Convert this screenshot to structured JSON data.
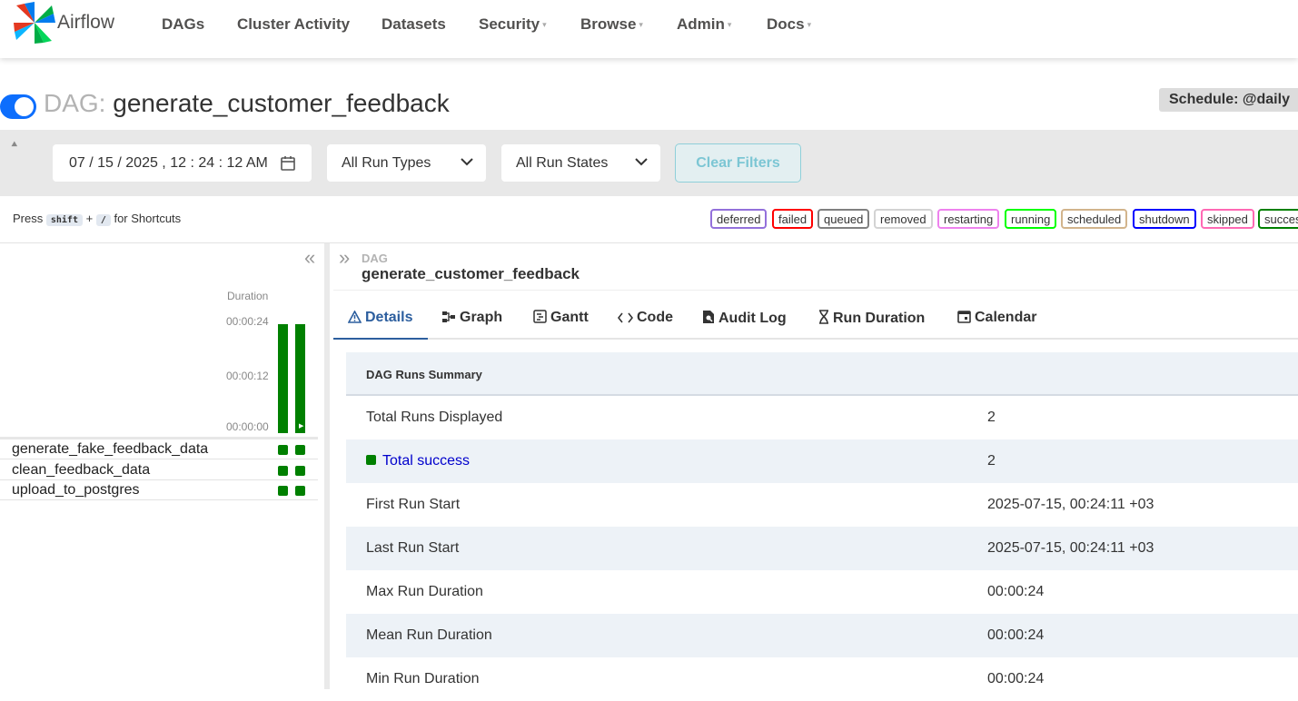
{
  "nav": {
    "brand": "Airflow",
    "items": [
      {
        "label": "DAGs",
        "dropdown": false
      },
      {
        "label": "Cluster Activity",
        "dropdown": false
      },
      {
        "label": "Datasets",
        "dropdown": false
      },
      {
        "label": "Security",
        "dropdown": true
      },
      {
        "label": "Browse",
        "dropdown": true
      },
      {
        "label": "Admin",
        "dropdown": true
      },
      {
        "label": "Docs",
        "dropdown": true
      }
    ]
  },
  "header": {
    "prefix": "DAG:",
    "dag_id": "generate_customer_feedback",
    "schedule": "Schedule: @daily",
    "paused": false
  },
  "filters": {
    "date": "07 / 15 / 2025 ,   12 : 24 : 12    AM",
    "run_types": "All Run Types",
    "run_states": "All Run States",
    "clear_label": "Clear Filters"
  },
  "shortcuts": {
    "press": "Press",
    "key1": "shift",
    "plus": "+",
    "key2": "/",
    "suffix": "for Shortcuts"
  },
  "states": [
    {
      "label": "deferred",
      "color": "#9370db"
    },
    {
      "label": "failed",
      "color": "#ff0000"
    },
    {
      "label": "queued",
      "color": "#808080"
    },
    {
      "label": "removed",
      "color": "#d3d3d3"
    },
    {
      "label": "restarting",
      "color": "#ee82ee"
    },
    {
      "label": "running",
      "color": "#00ff00"
    },
    {
      "label": "scheduled",
      "color": "#d2b48c"
    },
    {
      "label": "shutdown",
      "color": "#0000ff"
    },
    {
      "label": "skipped",
      "color": "#ff69b4"
    },
    {
      "label": "success",
      "color": "#008000"
    }
  ],
  "grid": {
    "duration_label": "Duration",
    "ticks": [
      "00:00:24",
      "00:00:12",
      "00:00:00"
    ],
    "runs": [
      {
        "duration_fraction": 1.0,
        "state": "success"
      },
      {
        "duration_fraction": 1.0,
        "state": "success"
      }
    ],
    "tasks": [
      {
        "name": "generate_fake_feedback_data"
      },
      {
        "name": "clean_feedback_data"
      },
      {
        "name": "upload_to_postgres"
      }
    ]
  },
  "details": {
    "label": "DAG",
    "title": "generate_customer_feedback",
    "tabs": [
      {
        "label": "Details",
        "icon": "warning-triangle-icon"
      },
      {
        "label": "Graph",
        "icon": "graph-icon"
      },
      {
        "label": "Gantt",
        "icon": "gantt-icon"
      },
      {
        "label": "Code",
        "icon": "code-icon"
      },
      {
        "label": "Audit Log",
        "icon": "audit-log-icon"
      },
      {
        "label": "Run Duration",
        "icon": "hourglass-icon"
      },
      {
        "label": "Calendar",
        "icon": "calendar-icon"
      }
    ],
    "summary_title": "DAG Runs Summary",
    "rows": [
      {
        "key": "Total Runs Displayed",
        "value": "2"
      },
      {
        "key": "Total success",
        "value": "2"
      },
      {
        "key": "First Run Start",
        "value": "2025-07-15, 00:24:11 +03"
      },
      {
        "key": "Last Run Start",
        "value": "2025-07-15, 00:24:11 +03"
      },
      {
        "key": "Max Run Duration",
        "value": "00:00:24"
      },
      {
        "key": "Mean Run Duration",
        "value": "00:00:24"
      },
      {
        "key": "Min Run Duration",
        "value": "00:00:24"
      }
    ]
  }
}
